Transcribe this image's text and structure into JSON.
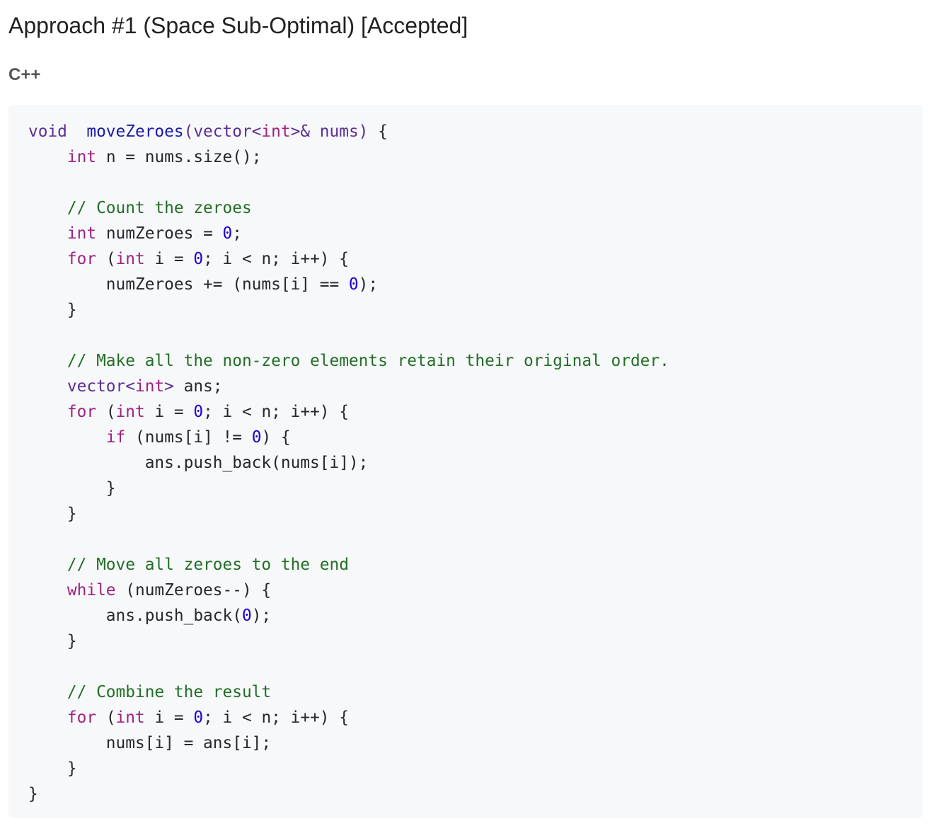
{
  "page": {
    "title": "Approach #1 (Space Sub-Optimal) [Accepted]",
    "language_label": "C++"
  },
  "colors": {
    "background": "#ffffff",
    "code_background": "#f6f8fa",
    "plain": "#24292e",
    "keyword": "#a0227f",
    "type": "#5c2f92",
    "function": "#1a1aa6",
    "number": "#1c00cf",
    "comment": "#236e25"
  },
  "code": {
    "language": "C++",
    "lines": [
      [
        [
          "type",
          "void"
        ],
        [
          "",
          "  "
        ],
        [
          "func",
          "moveZeroes"
        ],
        [
          "type",
          "(vector<"
        ],
        [
          "keyword",
          "int"
        ],
        [
          "type",
          ">& nums)"
        ],
        [
          "",
          " {"
        ]
      ],
      [
        [
          "",
          "    "
        ],
        [
          "keyword",
          "int"
        ],
        [
          "",
          " n = nums.size();"
        ]
      ],
      [],
      [
        [
          "",
          "    "
        ],
        [
          "comment",
          "// Count the zeroes"
        ]
      ],
      [
        [
          "",
          "    "
        ],
        [
          "keyword",
          "int"
        ],
        [
          "",
          " numZeroes = "
        ],
        [
          "number",
          "0"
        ],
        [
          "",
          ";"
        ]
      ],
      [
        [
          "",
          "    "
        ],
        [
          "keyword",
          "for"
        ],
        [
          "",
          " ("
        ],
        [
          "keyword",
          "int"
        ],
        [
          "",
          " i = "
        ],
        [
          "number",
          "0"
        ],
        [
          "",
          "; i < n; i++) {"
        ]
      ],
      [
        [
          "",
          "        numZeroes += (nums[i] == "
        ],
        [
          "number",
          "0"
        ],
        [
          "",
          ");"
        ]
      ],
      [
        [
          "",
          "    }"
        ]
      ],
      [],
      [
        [
          "",
          "    "
        ],
        [
          "comment",
          "// Make all the non-zero elements retain their original order."
        ]
      ],
      [
        [
          "",
          "    "
        ],
        [
          "type",
          "vector<"
        ],
        [
          "keyword",
          "int"
        ],
        [
          "type",
          ">"
        ],
        [
          "",
          " ans;"
        ]
      ],
      [
        [
          "",
          "    "
        ],
        [
          "keyword",
          "for"
        ],
        [
          "",
          " ("
        ],
        [
          "keyword",
          "int"
        ],
        [
          "",
          " i = "
        ],
        [
          "number",
          "0"
        ],
        [
          "",
          "; i < n; i++) {"
        ]
      ],
      [
        [
          "",
          "        "
        ],
        [
          "keyword",
          "if"
        ],
        [
          "",
          " (nums[i] != "
        ],
        [
          "number",
          "0"
        ],
        [
          "",
          ") {"
        ]
      ],
      [
        [
          "",
          "            ans.push_back(nums[i]);"
        ]
      ],
      [
        [
          "",
          "        }"
        ]
      ],
      [
        [
          "",
          "    }"
        ]
      ],
      [],
      [
        [
          "",
          "    "
        ],
        [
          "comment",
          "// Move all zeroes to the end"
        ]
      ],
      [
        [
          "",
          "    "
        ],
        [
          "keyword",
          "while"
        ],
        [
          "",
          " (numZeroes--) {"
        ]
      ],
      [
        [
          "",
          "        ans.push_back("
        ],
        [
          "number",
          "0"
        ],
        [
          "",
          ");"
        ]
      ],
      [
        [
          "",
          "    }"
        ]
      ],
      [],
      [
        [
          "",
          "    "
        ],
        [
          "comment",
          "// Combine the result"
        ]
      ],
      [
        [
          "",
          "    "
        ],
        [
          "keyword",
          "for"
        ],
        [
          "",
          " ("
        ],
        [
          "keyword",
          "int"
        ],
        [
          "",
          " i = "
        ],
        [
          "number",
          "0"
        ],
        [
          "",
          "; i < n; i++) {"
        ]
      ],
      [
        [
          "",
          "        nums[i] = ans[i];"
        ]
      ],
      [
        [
          "",
          "    }"
        ]
      ],
      [
        [
          "",
          "}"
        ]
      ]
    ]
  }
}
